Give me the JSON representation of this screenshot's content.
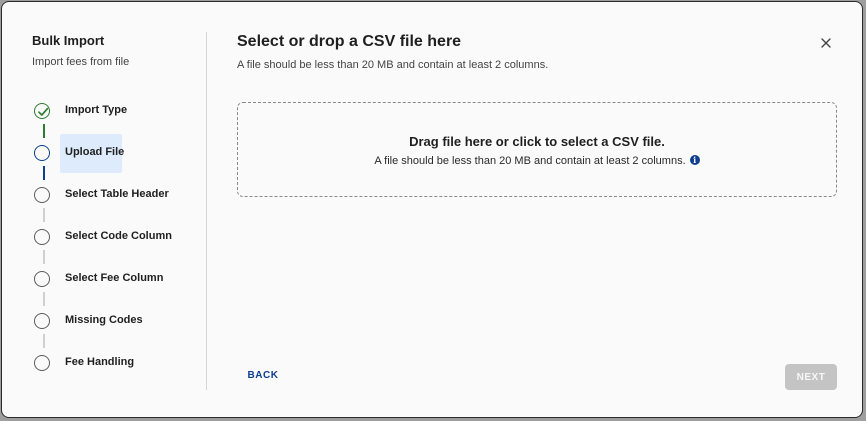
{
  "sidebar": {
    "title": "Bulk Import",
    "subtitle": "Import fees from file",
    "steps": [
      {
        "label": "Import Type",
        "state": "completed"
      },
      {
        "label": "Upload File",
        "state": "active"
      },
      {
        "label": "Select Table Header",
        "state": "pending"
      },
      {
        "label": "Select Code Column",
        "state": "pending"
      },
      {
        "label": "Select Fee Column",
        "state": "pending"
      },
      {
        "label": "Missing Codes",
        "state": "pending"
      },
      {
        "label": "Fee Handling",
        "state": "pending"
      }
    ]
  },
  "main": {
    "title": "Select or drop a CSV file here",
    "subtitle": "A file should be less than 20 MB and contain at least 2 columns.",
    "dropzone": {
      "title": "Drag file here or click to select a CSV file.",
      "hint": "A file should be less than 20 MB and contain at least 2 columns.",
      "info_icon": "i"
    }
  },
  "footer": {
    "back_label": "BACK",
    "next_label": "NEXT",
    "next_enabled": false
  },
  "colors": {
    "accent": "#0e3f8f",
    "success": "#2e7d32",
    "active_step_bg": "#ddebfc",
    "disabled_button": "#c4c4c4"
  },
  "icons": {
    "close": "close-icon",
    "completed": "check-circle-icon",
    "info": "info-icon"
  }
}
